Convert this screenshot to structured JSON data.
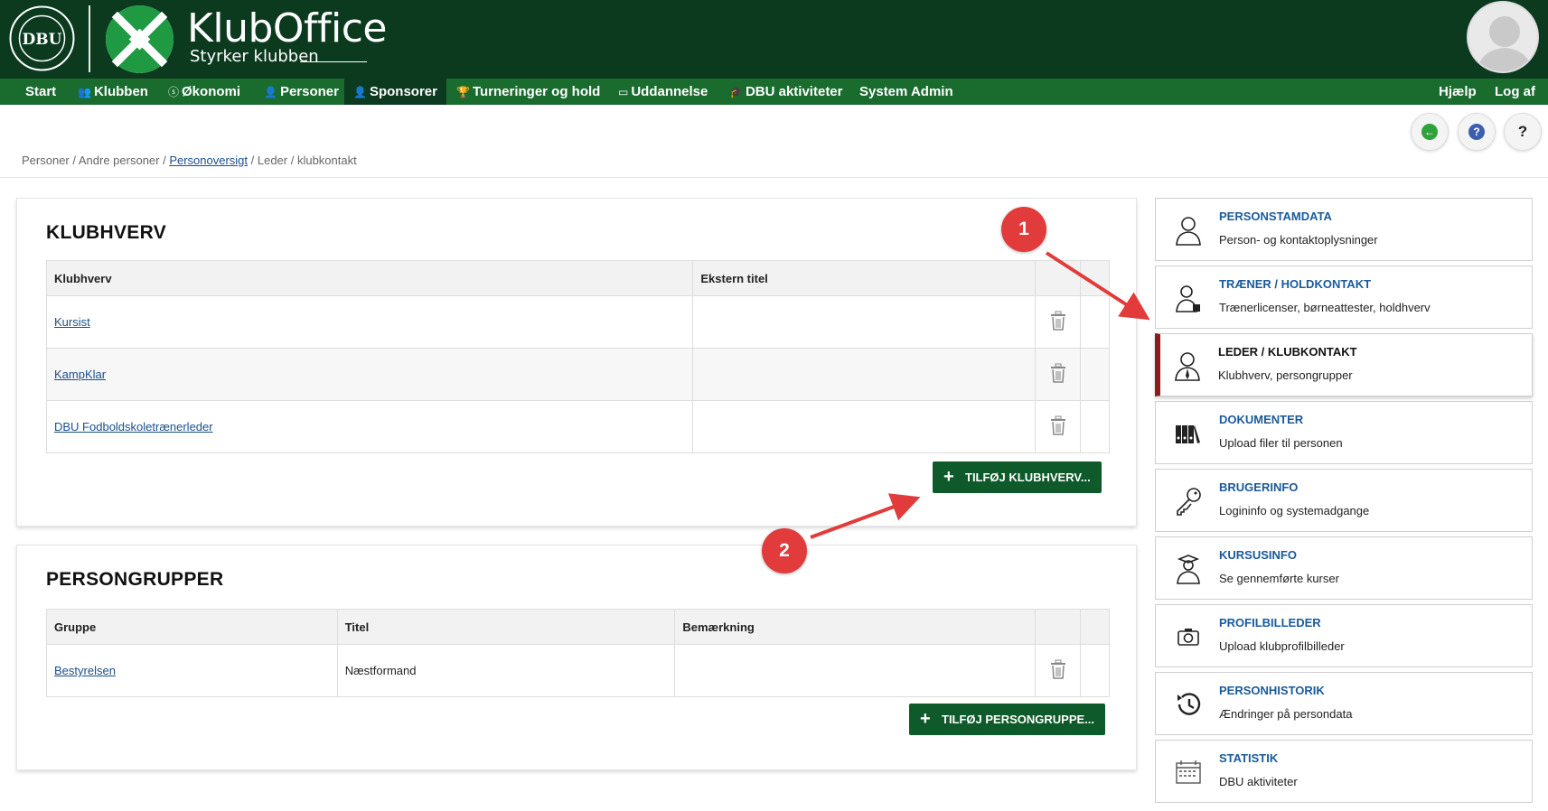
{
  "app": {
    "title": "KlubOffice",
    "subtitle": "Styrker klubben"
  },
  "nav": [
    {
      "label": "Start",
      "icon": ""
    },
    {
      "label": "Klubben",
      "icon": "people-icon"
    },
    {
      "label": "Økonomi",
      "icon": "coin-icon"
    },
    {
      "label": "Personer",
      "icon": "person-icon"
    },
    {
      "label": "Sponsorer",
      "icon": "sponsor-icon"
    },
    {
      "label": "Turneringer og hold",
      "icon": "trophy-icon"
    },
    {
      "label": "Uddannelse",
      "icon": "presentation-icon"
    },
    {
      "label": "DBU aktiviteter",
      "icon": "graduation-cap-icon"
    },
    {
      "label": "System Admin",
      "icon": ""
    }
  ],
  "nav_right": {
    "help": "Hjælp",
    "logout": "Log af"
  },
  "breadcrumb": {
    "part1": "Personer / Andre personer / ",
    "link": "Personoversigt",
    "part2": " / Leder / klubkontakt"
  },
  "klubhverv": {
    "title": "KLUBHVERV",
    "columns": [
      "Klubhverv",
      "Ekstern titel"
    ],
    "rows": [
      {
        "name": "Kursist",
        "ext": ""
      },
      {
        "name": "KampKlar",
        "ext": ""
      },
      {
        "name": "DBU Fodboldskoletrænerleder",
        "ext": ""
      }
    ],
    "add_button": "TILFØJ KLUBHVERV..."
  },
  "persongrupper": {
    "title": "PERSONGRUPPER",
    "columns": [
      "Gruppe",
      "Titel",
      "Bemærkning"
    ],
    "rows": [
      {
        "group": "Bestyrelsen",
        "title": "Næstformand",
        "note": ""
      }
    ],
    "add_button": "TILFØJ PERSONGRUPPE..."
  },
  "sidebar": [
    {
      "title": "PERSONSTAMDATA",
      "desc": "Person- og kontaktoplysninger",
      "icon": "person-outline-icon"
    },
    {
      "title": "TRÆNER / HOLDKONTAKT",
      "desc": "Trænerlicenser, børneattester, holdhverv",
      "icon": "coach-icon"
    },
    {
      "title": "LEDER / KLUBKONTAKT",
      "desc": "Klubhverv, persongrupper",
      "icon": "leader-tie-icon",
      "active": true
    },
    {
      "title": "DOKUMENTER",
      "desc": "Upload filer til personen",
      "icon": "binders-icon"
    },
    {
      "title": "BRUGERINFO",
      "desc": "Logininfo og systemadgange",
      "icon": "key-icon"
    },
    {
      "title": "KURSUSINFO",
      "desc": "Se gennemførte kurser",
      "icon": "graduate-icon"
    },
    {
      "title": "PROFILBILLEDER",
      "desc": "Upload klubprofilbilleder",
      "icon": "camera-icon"
    },
    {
      "title": "PERSONHISTORIK",
      "desc": "Ændringer på persondata",
      "icon": "history-icon"
    },
    {
      "title": "STATISTIK",
      "desc": "DBU aktiviteter",
      "icon": "calendar-icon"
    }
  ],
  "callouts": [
    "1",
    "2"
  ],
  "colors": {
    "header": "#0b3a1f",
    "nav": "#1a6b2e",
    "button": "#0e5a2a",
    "link": "#1a5a9a",
    "active_marker": "#8b1c1c",
    "callout": "#e23b3b"
  }
}
